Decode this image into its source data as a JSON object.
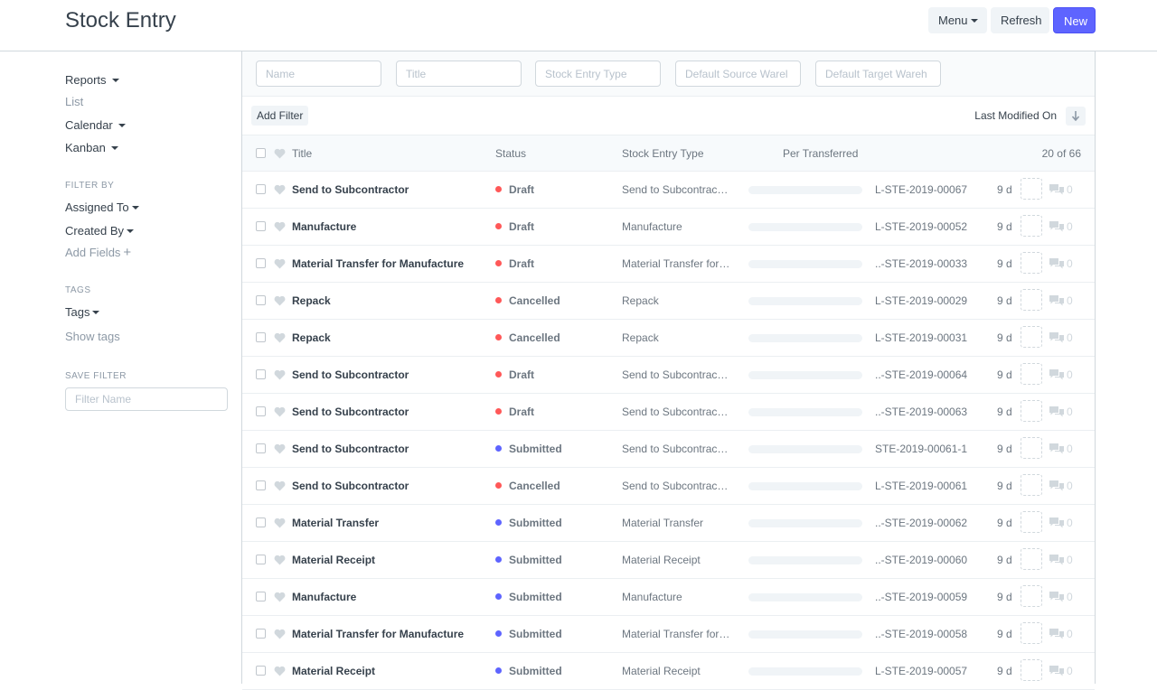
{
  "header": {
    "title": "Stock Entry",
    "menu_label": "Menu",
    "refresh_label": "Refresh",
    "new_label": "New"
  },
  "sidebar": {
    "views": [
      {
        "label": "Reports",
        "dropdown": true
      },
      {
        "label": "List",
        "dropdown": false
      },
      {
        "label": "Calendar",
        "dropdown": true
      },
      {
        "label": "Kanban",
        "dropdown": true
      }
    ],
    "filter_by_heading": "FILTER BY",
    "assigned_to": "Assigned To",
    "created_by": "Created By",
    "add_fields": "Add Fields",
    "tags_heading": "TAGS",
    "tags": "Tags",
    "show_tags": "Show tags",
    "save_filter_heading": "SAVE FILTER",
    "filter_name_placeholder": "Filter Name"
  },
  "standard_filters": {
    "name_placeholder": "Name",
    "title_placeholder": "Title",
    "type_placeholder": "Stock Entry Type",
    "source_placeholder": "Default Source Warel",
    "target_placeholder": "Default Target Wareh"
  },
  "filter_bar": {
    "add_filter": "Add Filter",
    "sort_label": "Last Modified On"
  },
  "columns": {
    "title": "Title",
    "status": "Status",
    "type": "Stock Entry Type",
    "per_transferred": "Per Transferred",
    "count": "20 of 66"
  },
  "colors": {
    "draft": "#ff5858",
    "cancelled": "#ff5858",
    "submitted": "#5e64ff",
    "primary": "#5e64ff"
  },
  "rows": [
    {
      "title": "Send to Subcontractor",
      "status": "Draft",
      "status_color": "#ff5858",
      "type": "Send to Subcontrac…",
      "name": "L-STE-2019-00067",
      "modified": "9 d",
      "comments": "0",
      "per_transferred": 0
    },
    {
      "title": "Manufacture",
      "status": "Draft",
      "status_color": "#ff5858",
      "type": "Manufacture",
      "name": "L-STE-2019-00052",
      "modified": "9 d",
      "comments": "0",
      "per_transferred": 0
    },
    {
      "title": "Material Transfer for Manufacture",
      "status": "Draft",
      "status_color": "#ff5858",
      "type": "Material Transfer for…",
      "name": "..-STE-2019-00033",
      "modified": "9 d",
      "comments": "0",
      "per_transferred": 0
    },
    {
      "title": "Repack",
      "status": "Cancelled",
      "status_color": "#ff5858",
      "type": "Repack",
      "name": "L-STE-2019-00029",
      "modified": "9 d",
      "comments": "0",
      "per_transferred": 0
    },
    {
      "title": "Repack",
      "status": "Cancelled",
      "status_color": "#ff5858",
      "type": "Repack",
      "name": "L-STE-2019-00031",
      "modified": "9 d",
      "comments": "0",
      "per_transferred": 0
    },
    {
      "title": "Send to Subcontractor",
      "status": "Draft",
      "status_color": "#ff5858",
      "type": "Send to Subcontrac…",
      "name": "..-STE-2019-00064",
      "modified": "9 d",
      "comments": "0",
      "per_transferred": 0
    },
    {
      "title": "Send to Subcontractor",
      "status": "Draft",
      "status_color": "#ff5858",
      "type": "Send to Subcontrac…",
      "name": "..-STE-2019-00063",
      "modified": "9 d",
      "comments": "0",
      "per_transferred": 0
    },
    {
      "title": "Send to Subcontractor",
      "status": "Submitted",
      "status_color": "#5e64ff",
      "type": "Send to Subcontrac…",
      "name": "STE-2019-00061-1",
      "modified": "9 d",
      "comments": "0",
      "per_transferred": 0
    },
    {
      "title": "Send to Subcontractor",
      "status": "Cancelled",
      "status_color": "#ff5858",
      "type": "Send to Subcontrac…",
      "name": "L-STE-2019-00061",
      "modified": "9 d",
      "comments": "0",
      "per_transferred": 0
    },
    {
      "title": "Material Transfer",
      "status": "Submitted",
      "status_color": "#5e64ff",
      "type": "Material Transfer",
      "name": "..-STE-2019-00062",
      "modified": "9 d",
      "comments": "0",
      "per_transferred": 0
    },
    {
      "title": "Material Receipt",
      "status": "Submitted",
      "status_color": "#5e64ff",
      "type": "Material Receipt",
      "name": "..-STE-2019-00060",
      "modified": "9 d",
      "comments": "0",
      "per_transferred": 0
    },
    {
      "title": "Manufacture",
      "status": "Submitted",
      "status_color": "#5e64ff",
      "type": "Manufacture",
      "name": "..-STE-2019-00059",
      "modified": "9 d",
      "comments": "0",
      "per_transferred": 0
    },
    {
      "title": "Material Transfer for Manufacture",
      "status": "Submitted",
      "status_color": "#5e64ff",
      "type": "Material Transfer for…",
      "name": "..-STE-2019-00058",
      "modified": "9 d",
      "comments": "0",
      "per_transferred": 0
    },
    {
      "title": "Material Receipt",
      "status": "Submitted",
      "status_color": "#5e64ff",
      "type": "Material Receipt",
      "name": "L-STE-2019-00057",
      "modified": "9 d",
      "comments": "0",
      "per_transferred": 0
    }
  ]
}
